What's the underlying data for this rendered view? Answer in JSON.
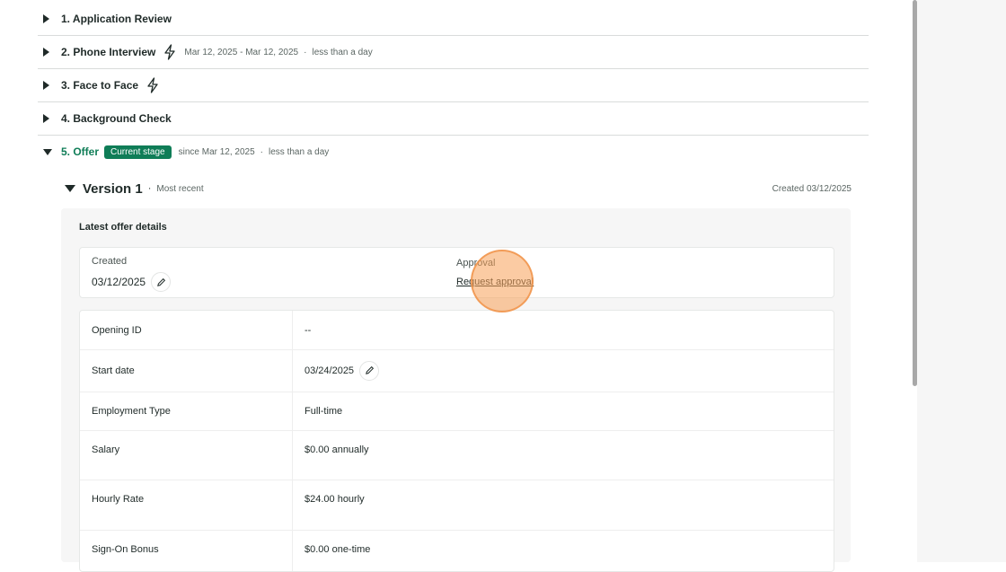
{
  "stages": [
    {
      "label": "1. Application Review"
    },
    {
      "label": "2. Phone Interview",
      "dates": "Mar 12, 2025 - Mar 12, 2025",
      "duration": "less than a day"
    },
    {
      "label": "3. Face to Face"
    },
    {
      "label": "4. Background Check"
    },
    {
      "label": "5. Offer",
      "badge": "Current stage",
      "since": "since Mar 12, 2025",
      "duration": "less than a day"
    }
  ],
  "version": {
    "title": "Version 1",
    "separator": "·",
    "subtitle": "Most recent",
    "created": "Created 03/12/2025"
  },
  "offer_details": {
    "title": "Latest offer details",
    "created_label": "Created",
    "created_value": "03/12/2025",
    "approval_label": "Approval",
    "approval_link": "Request approval"
  },
  "table": [
    {
      "label": "Opening ID",
      "value": "--"
    },
    {
      "label": "Start date",
      "value": "03/24/2025"
    },
    {
      "label": "Employment Type",
      "value": "Full-time"
    },
    {
      "label": "Salary",
      "value": "$0.00 annually"
    },
    {
      "label": "Hourly Rate",
      "value": "$24.00 hourly"
    },
    {
      "label": "Sign-On Bonus",
      "value": "$0.00 one-time"
    }
  ],
  "icons": {
    "bolt": "lightning-bolt-icon",
    "edit": "pencil-icon",
    "expand": "triangle-right-icon",
    "collapse": "triangle-down-icon"
  },
  "colors": {
    "accent": "#0f7d57",
    "click_highlight": "#f7a158"
  }
}
